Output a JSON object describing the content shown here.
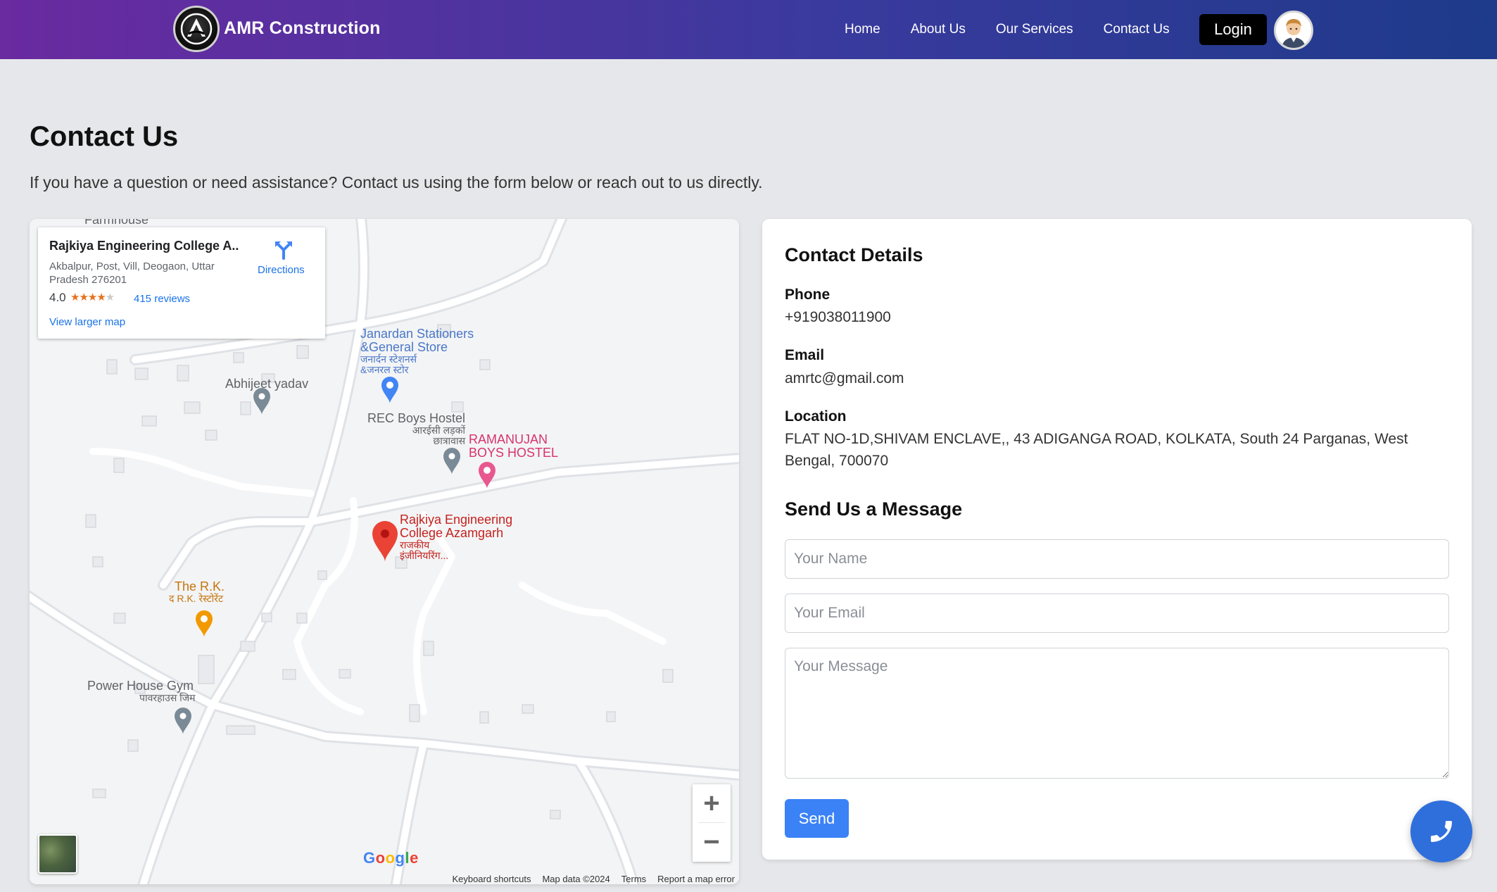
{
  "navbar": {
    "brand": "AMR Construction",
    "links": [
      "Home",
      "About Us",
      "Our Services",
      "Contact Us"
    ],
    "login_label": "Login"
  },
  "page": {
    "title": "Contact Us",
    "subtitle": "If you have a question or need assistance? Contact us using the form below or reach out to us directly."
  },
  "map": {
    "place_title": "Rajkiya Engineering College A...",
    "address": "Akbalpur, Post, Vill, Deogaon, Uttar Pradesh 276201",
    "rating": "4.0",
    "rating_value": 4.0,
    "reviews": "415 reviews",
    "view_larger": "View larger map",
    "directions": "Directions",
    "pois": {
      "farmhouse": "Farmhouse",
      "janardan_line1": "Janardan Stationers",
      "janardan_line2": "&General Store",
      "janardan_hi1": "जनार्दन स्टेशनर्स",
      "janardan_hi2": "&जनरल स्टोर",
      "abhijeet": "Abhijeet yadav",
      "rec_boys": "REC Boys Hostel",
      "rec_boys_hi1": "आरईसी लड़कों",
      "rec_boys_hi2": "छात्रावास",
      "ramanujan_line1": "RAMANUJAN",
      "ramanujan_line2": "BOYS HOSTEL",
      "rajkiya_line1": "Rajkiya Engineering",
      "rajkiya_line2": "College Azamgarh",
      "rajkiya_hi1": "राजकीय",
      "rajkiya_hi2": "इंजीनियरिंग...",
      "rk_line1": "The R.K.",
      "rk_hi": "द R.K. रेस्टोरेंट",
      "gym_line1": "Power House Gym",
      "gym_hi": "पावरहाउस जिम"
    },
    "google": "Google",
    "footer": [
      "Keyboard shortcuts",
      "Map data ©2024",
      "Terms",
      "Report a map error"
    ]
  },
  "contact": {
    "details_heading": "Contact Details",
    "phone_label": "Phone",
    "phone": "+919038011900",
    "email_label": "Email",
    "email": "amrtc@gmail.com",
    "location_label": "Location",
    "location": "FLAT NO-1D,SHIVAM ENCLAVE,, 43 ADIGANGA ROAD, KOLKATA, South 24 Parganas, West Bengal, 700070",
    "message_heading": "Send Us a Message",
    "name_placeholder": "Your Name",
    "email_placeholder": "Your Email",
    "message_placeholder": "Your Message",
    "send_label": "Send"
  },
  "colors": {
    "nav_start": "#6a2aa0",
    "nav_end": "#1e3a8a",
    "accent": "#3b82f6",
    "fab": "#2f6fdc"
  },
  "icons": {
    "logo": "amr-logo-icon",
    "avatar": "user-avatar-icon",
    "directions": "directions-icon",
    "fab": "phone-icon"
  }
}
